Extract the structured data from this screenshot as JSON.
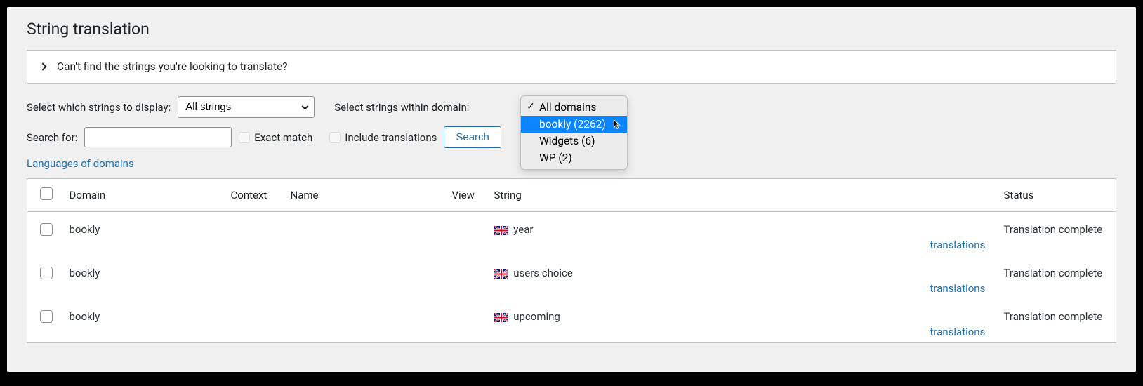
{
  "page": {
    "title": "String translation"
  },
  "accordion": {
    "title": "Can't find the strings you're looking to translate?"
  },
  "filters": {
    "display_label": "Select which strings to display:",
    "display_value": "All strings",
    "domain_label": "Select strings within domain:",
    "search_label": "Search for:",
    "search_value": "",
    "exact_match_label": "Exact match",
    "include_translations_label": "Include translations",
    "search_button": "Search",
    "languages_link": "Languages of domains"
  },
  "dropdown": {
    "items": [
      {
        "label": "All domains",
        "checked": true,
        "highlighted": false
      },
      {
        "label": "bookly (2262)",
        "checked": false,
        "highlighted": true
      },
      {
        "label": "Widgets (6)",
        "checked": false,
        "highlighted": false
      },
      {
        "label": "WP (2)",
        "checked": false,
        "highlighted": false
      }
    ]
  },
  "table": {
    "headers": {
      "domain": "Domain",
      "context": "Context",
      "name": "Name",
      "view": "View",
      "string": "String",
      "status": "Status"
    },
    "translations_label": "translations",
    "rows": [
      {
        "domain": "bookly",
        "context": "",
        "name": "",
        "view": "",
        "string": "year",
        "status": "Translation complete"
      },
      {
        "domain": "bookly",
        "context": "",
        "name": "",
        "view": "",
        "string": "users choice",
        "status": "Translation complete"
      },
      {
        "domain": "bookly",
        "context": "",
        "name": "",
        "view": "",
        "string": "upcoming",
        "status": "Translation complete"
      }
    ]
  }
}
